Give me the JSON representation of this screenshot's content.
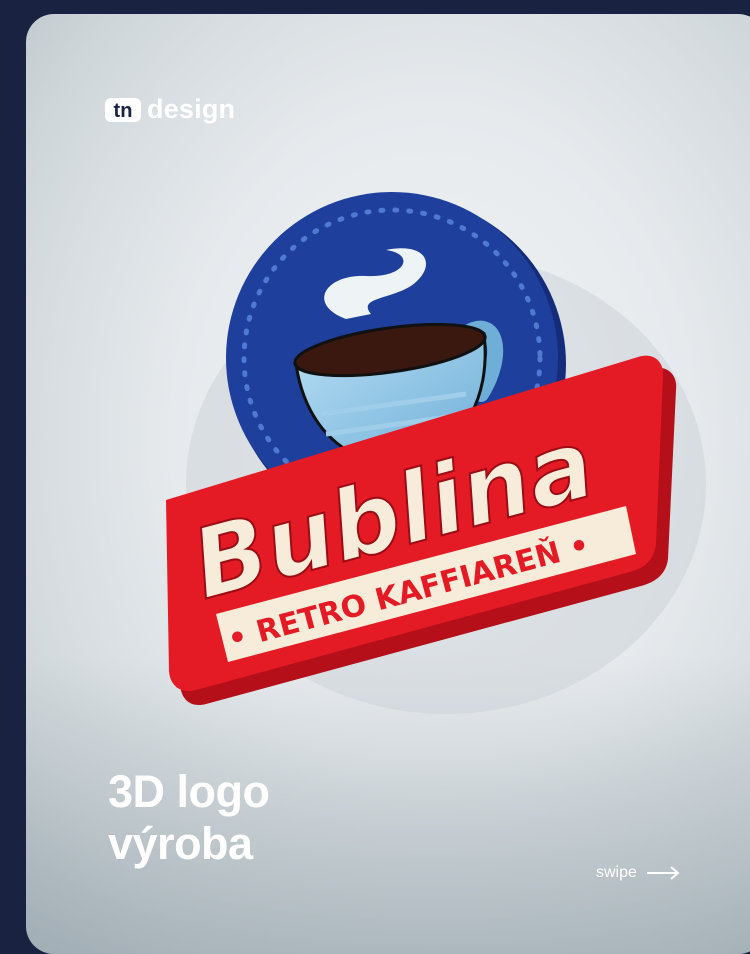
{
  "brand": {
    "name": "design",
    "mark": "tn"
  },
  "logo_sign": {
    "name": "Bublina",
    "tagline": "• RETRO KAFFIAREŇ •",
    "icon": "coffee-cup-icon",
    "colors": {
      "red": "#e41a25",
      "blue": "#1e3f9c",
      "cream": "#f6ecd9",
      "cup": "#8ec8ea",
      "coffee": "#3a1810"
    }
  },
  "headline": {
    "line1": "3D logo",
    "line2": "výroba"
  },
  "swipe": {
    "label": "swipe",
    "icon": "arrow-right-icon"
  }
}
